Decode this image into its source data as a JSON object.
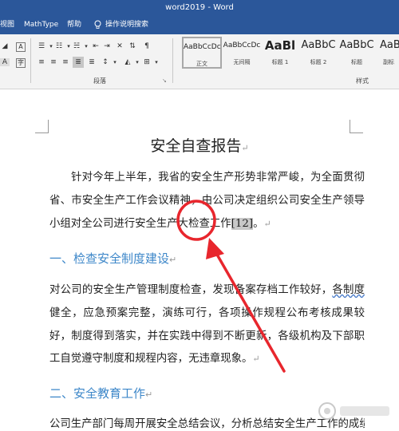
{
  "window": {
    "title": "word2019 - Word"
  },
  "menu": {
    "view": "视图",
    "mathtype": "MathType",
    "help": "帮助",
    "tell_me": "操作说明搜索"
  },
  "ribbon": {
    "paragraph_group": "段落",
    "styles_group": "样式",
    "styles": [
      {
        "sample": "AaBbCcDc",
        "name": "正文",
        "selected": true
      },
      {
        "sample": "AaBbCcDc",
        "name": "无间隔",
        "selected": false
      },
      {
        "sample": "AaBl",
        "name": "标题 1",
        "selected": false
      },
      {
        "sample": "AaBbC",
        "name": "标题 2",
        "selected": false
      },
      {
        "sample": "AaBbC",
        "name": "标题",
        "selected": false
      },
      {
        "sample": "AaBbC",
        "name": "副标",
        "selected": false
      }
    ]
  },
  "document": {
    "title": "安全自查报告",
    "p1_text": "针对今年上半年，我省的安全生产形势非常严峻，为全面贯彻省、市安全生产工作会议精神，由公司决定组织公司安全生产领导小组对全公司进行安全生产大检查工作",
    "p1_citation": "[12]",
    "p1_end": "。",
    "h1": "一、检查安全制度建设",
    "p2_before": "对公司的安全生产管理制度检查，发现备案存档工作较好，",
    "p2_underlined": "各制度",
    "p2_after": "健全，应急预案完整，演练可行，各项操作规程公布考核成果较好，制度得到落实，并在实践中得到不断更新，各级机构及下部职工自觉遵守制度和规程内容，无违章现象。",
    "h2": "二、安全教育工作",
    "p3_text": "公司生产部门每周开展安全总结会议，分析总结安全生产工作的成绩",
    "para_mark": "↵"
  },
  "colors": {
    "accent": "#2b579a",
    "heading": "#3d87c9",
    "annotation": "#e8262d"
  }
}
